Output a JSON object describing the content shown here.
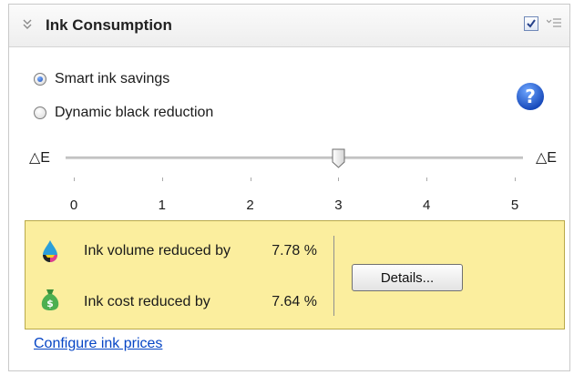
{
  "header": {
    "title": "Ink Consumption",
    "enabled": true,
    "collapse_icon": "double-chevron-icon",
    "menu_icon": "panel-menu-icon"
  },
  "modes": {
    "options": [
      {
        "label": "Smart ink savings",
        "selected": true
      },
      {
        "label": "Dynamic black reduction",
        "selected": false
      }
    ]
  },
  "help": {
    "icon": "help-icon",
    "color": "#1b5fd2"
  },
  "slider": {
    "left_label": "△E",
    "right_label": "△E",
    "min": 0,
    "max": 5,
    "value": 3,
    "ticks": [
      "0",
      "1",
      "2",
      "3",
      "4",
      "5"
    ]
  },
  "savings": {
    "background": "#fbee9e",
    "volume": {
      "label": "Ink volume reduced by",
      "value": "7.78 %",
      "icon": "ink-drop-icon"
    },
    "cost": {
      "label": "Ink cost reduced by",
      "value": "7.64 %",
      "icon": "money-bag-icon"
    },
    "details_label": "Details..."
  },
  "footer": {
    "configure_link": "Configure ink prices",
    "link_color": "#0645c5"
  }
}
